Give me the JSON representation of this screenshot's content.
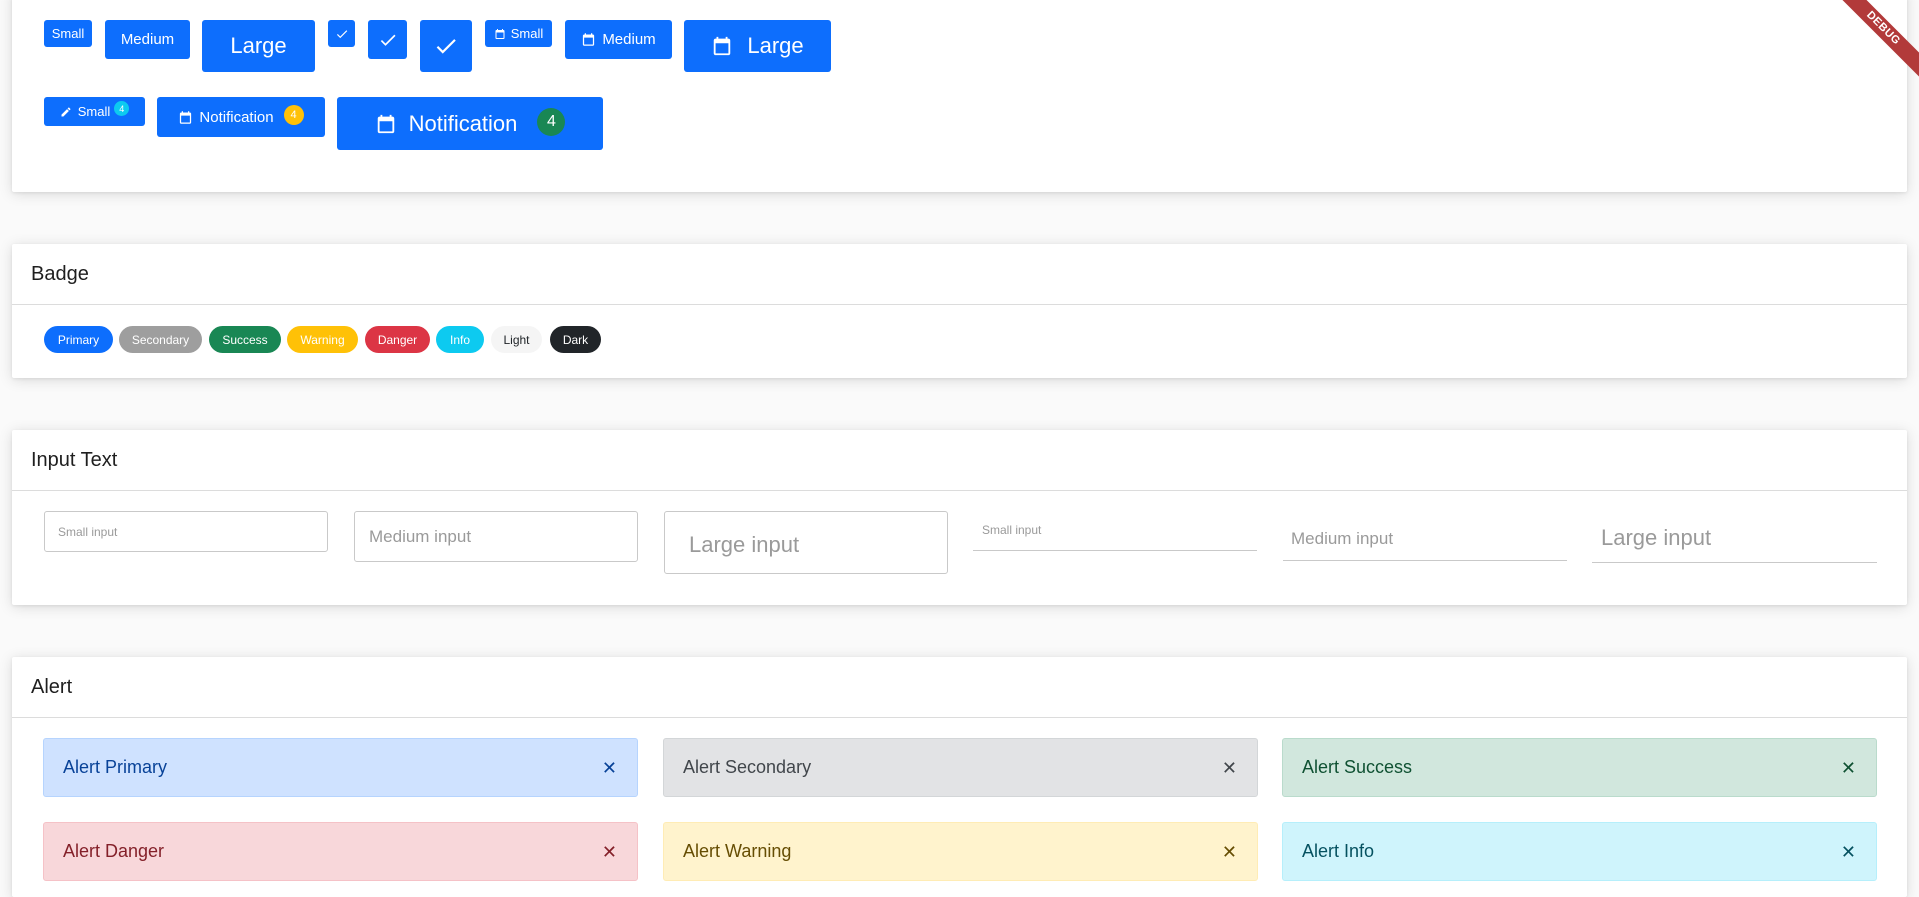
{
  "buttons": {
    "row1": {
      "small": "Small",
      "medium": "Medium",
      "large": "Large",
      "icon_small": "Small",
      "icon_medium": "Medium",
      "icon_large": "Large"
    },
    "row2": {
      "small": "Small",
      "small_count": "4",
      "medium": "Notification",
      "medium_count": "4",
      "large": "Notification",
      "large_count": "4"
    }
  },
  "badge_card": {
    "title": "Badge",
    "items": [
      "Primary",
      "Secondary",
      "Success",
      "Warning",
      "Danger",
      "Info",
      "Light",
      "Dark"
    ]
  },
  "input_card": {
    "title": "Input Text",
    "placeholders": [
      "Small input",
      "Medium input",
      "Large input",
      "Small input",
      "Medium input",
      "Large input"
    ]
  },
  "alert_card": {
    "title": "Alert",
    "alerts": [
      "Alert Primary",
      "Alert Secondary",
      "Alert Success",
      "Alert Danger",
      "Alert Warning",
      "Alert Info"
    ],
    "close_glyph": "✕"
  },
  "debug_banner": "DEBUG",
  "colors": {
    "primary": "#0d6efd",
    "secondary": "#9e9e9e",
    "success": "#198754",
    "warning": "#ffc107",
    "danger": "#dc3545",
    "info": "#0dcaf0",
    "light": "#f8f9fa",
    "dark": "#212529"
  }
}
